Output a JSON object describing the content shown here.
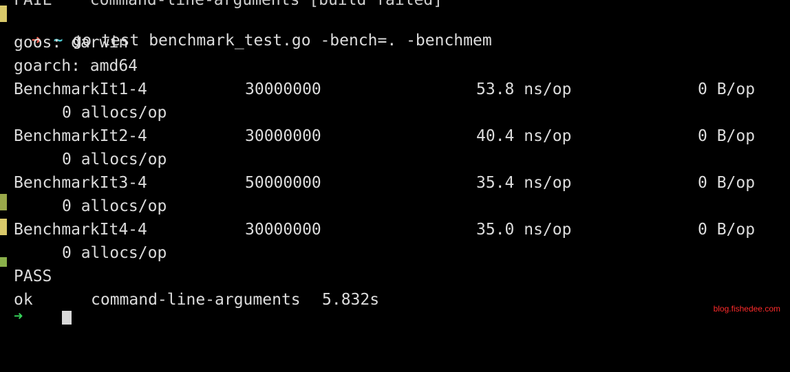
{
  "top_cut_line": "FAIL    command-line-arguments [build failed]",
  "prompt": {
    "arrow": "➜",
    "dir": "~",
    "command": "go test benchmark_test.go -bench=. -benchmem"
  },
  "env": {
    "goos": "goos: darwin",
    "goarch": "goarch: amd64"
  },
  "benchmarks": [
    {
      "name": "BenchmarkIt1-4",
      "iterations": "30000000",
      "ns_op": "53.8 ns/op",
      "b_op": "0 B/op",
      "allocs": "0 allocs/op"
    },
    {
      "name": "BenchmarkIt2-4",
      "iterations": "30000000",
      "ns_op": "40.4 ns/op",
      "b_op": "0 B/op",
      "allocs": "0 allocs/op"
    },
    {
      "name": "BenchmarkIt3-4",
      "iterations": "50000000",
      "ns_op": "35.4 ns/op",
      "b_op": "0 B/op",
      "allocs": "0 allocs/op"
    },
    {
      "name": "BenchmarkIt4-4",
      "iterations": "30000000",
      "ns_op": "35.0 ns/op",
      "b_op": "0 B/op",
      "allocs": "0 allocs/op"
    }
  ],
  "result": {
    "pass": "PASS",
    "ok": "ok",
    "package": "command-line-arguments",
    "time": "5.832s"
  },
  "watermark": "blog.fishedee.com",
  "colors": {
    "background": "#000000",
    "text": "#dcdcdc",
    "arrow": "#ff6b5b",
    "tilde": "#4ec9d0",
    "next_prompt": "#36d35a",
    "watermark": "#ff2b2b"
  }
}
